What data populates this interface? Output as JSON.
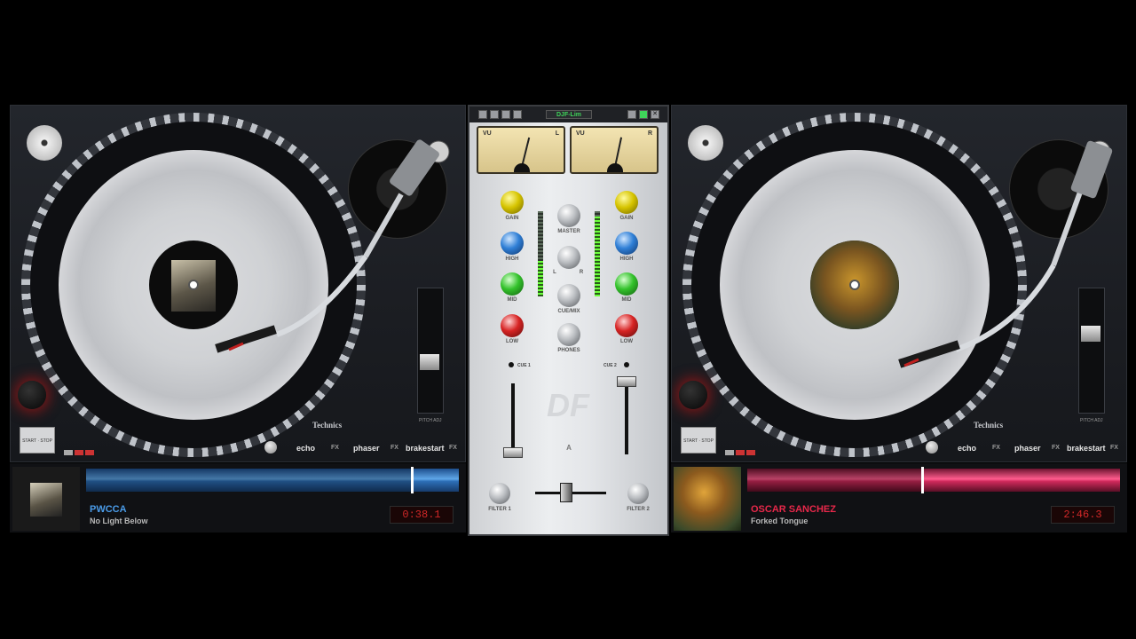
{
  "deck_left": {
    "fx": {
      "echo": "echo",
      "phaser": "phaser",
      "brakestart": "brakestart",
      "fx_tag": "FX"
    },
    "brand": "Technics",
    "pitch_label": "PITCH ADJ",
    "startstop": "START · STOP",
    "track": {
      "artist": "PWCCA",
      "title": "No Light Below",
      "time": "0:38.1"
    },
    "accent": "#5fa6e8"
  },
  "deck_right": {
    "fx": {
      "echo": "echo",
      "phaser": "phaser",
      "brakestart": "brakestart",
      "fx_tag": "FX"
    },
    "brand": "Technics",
    "pitch_label": "PITCH ADJ",
    "startstop": "START · STOP",
    "track": {
      "artist": "OSCAR SANCHEZ",
      "title": "Forked Tongue",
      "time": "2:46.3"
    },
    "accent": "#ff5c8e"
  },
  "mixer": {
    "title": "DJF-Lim",
    "vu_left": "VU",
    "vu_left_ch": "L",
    "vu_right": "VU",
    "vu_right_ch": "R",
    "left": {
      "gain": "GAIN",
      "high": "HIGH",
      "mid": "MID",
      "low": "LOW",
      "cue": "CUE 1",
      "filter": "FILTER 1"
    },
    "right": {
      "gain": "GAIN",
      "high": "HIGH",
      "mid": "MID",
      "low": "LOW",
      "cue": "CUE 2",
      "filter": "FILTER 2"
    },
    "center": {
      "master": "MASTER",
      "lr_l": "L",
      "lr_r": "R",
      "cuemix": "CUE/MIX",
      "phones": "PHONES",
      "crossfader_label": "A"
    },
    "logo": "DF"
  }
}
